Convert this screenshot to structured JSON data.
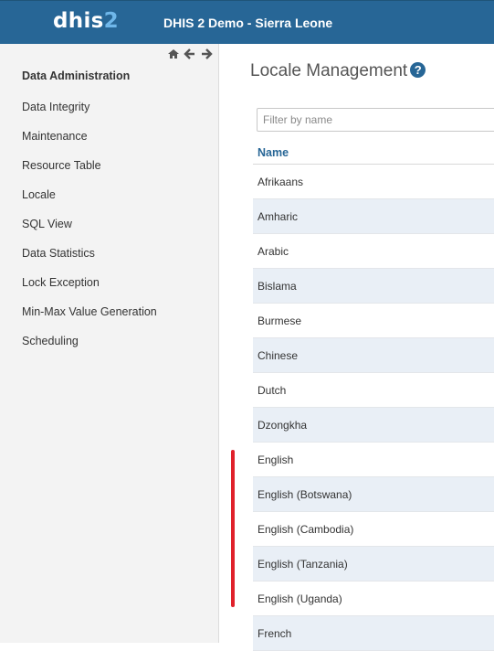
{
  "header": {
    "logo_main": "dhis",
    "logo_num": "2",
    "title": "DHIS 2 Demo - Sierra Leone"
  },
  "sidebar": {
    "nav_icons": [
      "home-icon",
      "arrow-left-icon",
      "arrow-right-icon"
    ],
    "section_title": "Data Administration",
    "items": [
      {
        "label": "Data Integrity"
      },
      {
        "label": "Maintenance"
      },
      {
        "label": "Resource Table"
      },
      {
        "label": "Locale"
      },
      {
        "label": "SQL View"
      },
      {
        "label": "Data Statistics"
      },
      {
        "label": "Lock Exception"
      },
      {
        "label": "Min-Max Value Generation"
      },
      {
        "label": "Scheduling"
      }
    ]
  },
  "main": {
    "title": "Locale Management",
    "help_icon": "?",
    "filter_placeholder": "Filter by name",
    "column_header": "Name",
    "rows": [
      "Afrikaans",
      "Amharic",
      "Arabic",
      "Bislama",
      "Burmese",
      "Chinese",
      "Dutch",
      "Dzongkha",
      "English",
      "English (Botswana)",
      "English (Cambodia)",
      "English (Tanzania)",
      "English (Uganda)",
      "French"
    ]
  },
  "colors": {
    "header_bg": "#276696",
    "logo_accent": "#6fb7ea",
    "link": "#276696",
    "row_alt": "#e9eff6",
    "annotation": "#e0212b"
  }
}
